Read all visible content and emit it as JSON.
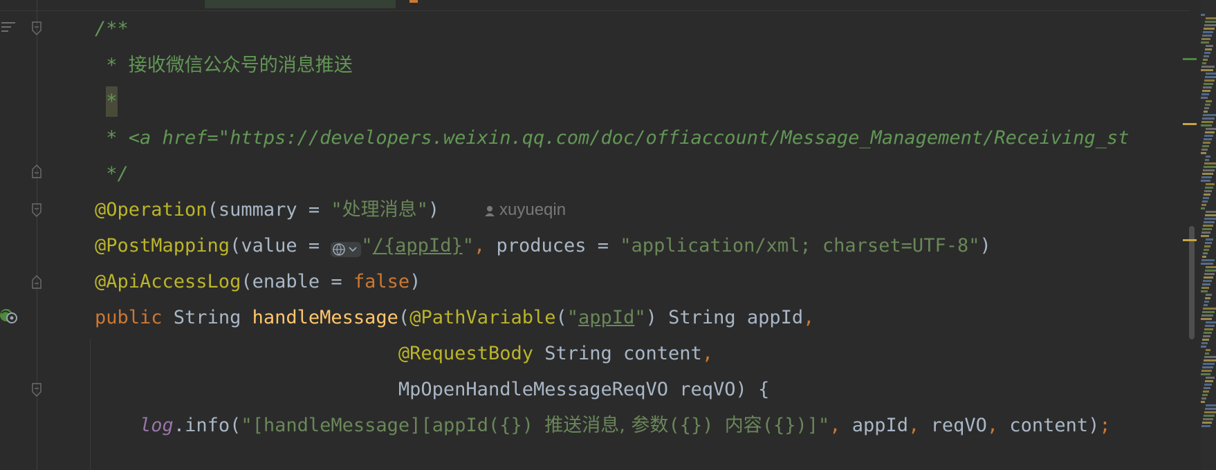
{
  "editor": {
    "lines": [
      {
        "segments": [
          {
            "cls": "cm",
            "text": "/**"
          }
        ]
      },
      {
        "segments": [
          {
            "cls": "cm",
            "text": " * "
          },
          {
            "cls": "cm cjk",
            "text": "接收微信公众号的消息推送"
          }
        ]
      },
      {
        "segments": [
          {
            "cls": "cm",
            "text": " "
          },
          {
            "cls": "cm caret-hl",
            "text": "*"
          }
        ]
      },
      {
        "segments": [
          {
            "cls": "cm",
            "text": " * <a href=\"https://developers.weixin.qq.com/doc/offiaccount/Message_Management/Receiving_st"
          }
        ]
      },
      {
        "segments": [
          {
            "cls": "cm",
            "text": " */"
          }
        ]
      },
      {
        "segments": [
          {
            "cls": "ann",
            "text": "@Operation"
          },
          {
            "cls": "",
            "text": "(summary = "
          },
          {
            "cls": "str",
            "text": "\""
          },
          {
            "cls": "str cjk",
            "text": "处理消息"
          },
          {
            "cls": "str",
            "text": "\""
          },
          {
            "cls": "",
            "text": ")"
          }
        ]
      },
      {
        "segments": [
          {
            "cls": "ann",
            "text": "@PostMapping"
          },
          {
            "cls": "",
            "text": "(value = "
          },
          {
            "cls": "inlay",
            "text": ""
          },
          {
            "cls": "str",
            "text": "\""
          },
          {
            "cls": "str und",
            "text": "/{appId}"
          },
          {
            "cls": "str",
            "text": "\""
          },
          {
            "cls": "kw",
            "text": ", "
          },
          {
            "cls": "",
            "text": "produces = "
          },
          {
            "cls": "str",
            "text": "\"application/xml; charset=UTF-8\""
          },
          {
            "cls": "",
            "text": ")"
          }
        ]
      },
      {
        "segments": [
          {
            "cls": "ann",
            "text": "@ApiAccessLog"
          },
          {
            "cls": "",
            "text": "(enable = "
          },
          {
            "cls": "kw",
            "text": "false"
          },
          {
            "cls": "",
            "text": ")"
          }
        ]
      },
      {
        "segments": [
          {
            "cls": "kw",
            "text": "public "
          },
          {
            "cls": "",
            "text": "String "
          },
          {
            "cls": "meth",
            "text": "handleMessage"
          },
          {
            "cls": "",
            "text": "("
          },
          {
            "cls": "ann",
            "text": "@PathVariable"
          },
          {
            "cls": "",
            "text": "("
          },
          {
            "cls": "str",
            "text": "\""
          },
          {
            "cls": "str und",
            "text": "appId"
          },
          {
            "cls": "str",
            "text": "\""
          },
          {
            "cls": "",
            "text": ") String appId"
          },
          {
            "cls": "kw",
            "text": ","
          }
        ]
      },
      {
        "segments": [
          {
            "cls": "",
            "text": "                           "
          },
          {
            "cls": "ann",
            "text": "@RequestBody"
          },
          {
            "cls": "",
            "text": " String content"
          },
          {
            "cls": "kw",
            "text": ","
          }
        ]
      },
      {
        "segments": [
          {
            "cls": "",
            "text": "                           MpOpenHandleMessageReqVO reqVO) {"
          }
        ]
      },
      {
        "segments": [
          {
            "cls": "",
            "text": "    "
          },
          {
            "cls": "fld",
            "text": "log"
          },
          {
            "cls": "",
            "text": ".info("
          },
          {
            "cls": "str",
            "text": "\"[handleMessage][appId({}) "
          },
          {
            "cls": "str cjk",
            "text": "推送消息, 参数"
          },
          {
            "cls": "str",
            "text": "({}) "
          },
          {
            "cls": "str cjk",
            "text": "内容"
          },
          {
            "cls": "str",
            "text": "({})]\""
          },
          {
            "cls": "kw",
            "text": ", "
          },
          {
            "cls": "",
            "text": "appId"
          },
          {
            "cls": "kw",
            "text": ", "
          },
          {
            "cls": "",
            "text": "reqVO"
          },
          {
            "cls": "kw",
            "text": ", "
          },
          {
            "cls": "",
            "text": "content)"
          },
          {
            "cls": "kw",
            "text": ";"
          }
        ]
      }
    ],
    "inlay_author": "xuyueqin",
    "icons": {
      "structure": "structure-icon",
      "web_endpoint": "web-endpoint-icon",
      "globe_inlay": "globe-icon",
      "author": "user-icon"
    },
    "colors": {
      "background": "#2b2b2b",
      "comment": "#629755",
      "annotation": "#bbb529",
      "keyword": "#cc7832",
      "string": "#6a8759",
      "method": "#ffc66d",
      "field": "#9876aa",
      "plain": "#a9b7c6"
    }
  }
}
